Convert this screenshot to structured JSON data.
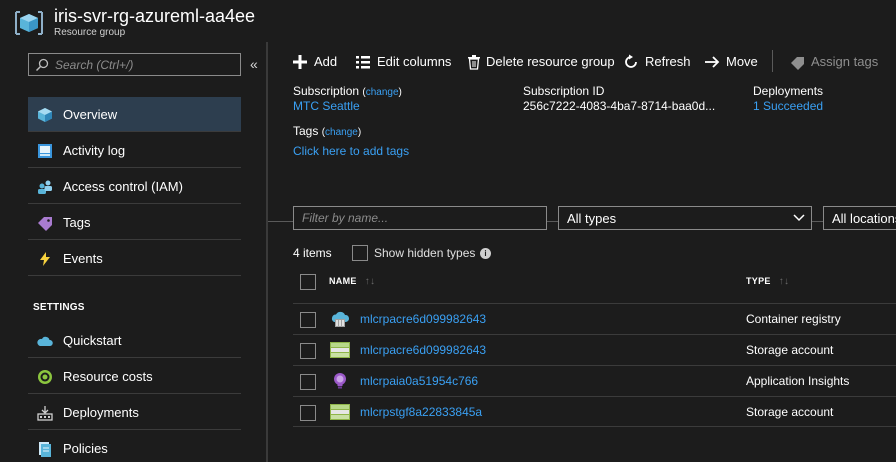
{
  "header": {
    "title": "iris-svr-rg-azureml-aa4ee",
    "subtitle": "Resource group",
    "icon": "resource-group-cube-icon"
  },
  "sidebar": {
    "search_placeholder": "Search (Ctrl+/)",
    "collapse_glyph": "«",
    "items": [
      {
        "label": "Overview",
        "icon": "overview-cube-icon",
        "active": true
      },
      {
        "label": "Activity log",
        "icon": "activity-log-icon"
      },
      {
        "label": "Access control (IAM)",
        "icon": "people-icon"
      },
      {
        "label": "Tags",
        "icon": "tag-icon"
      },
      {
        "label": "Events",
        "icon": "lightning-icon"
      }
    ],
    "settings_heading": "SETTINGS",
    "settings_items": [
      {
        "label": "Quickstart",
        "icon": "cloud-icon"
      },
      {
        "label": "Resource costs",
        "icon": "cost-icon"
      },
      {
        "label": "Deployments",
        "icon": "deployments-icon"
      },
      {
        "label": "Policies",
        "icon": "policies-icon"
      }
    ]
  },
  "toolbar": {
    "add": "Add",
    "edit_columns": "Edit columns",
    "delete": "Delete resource group",
    "refresh": "Refresh",
    "move": "Move",
    "assign_tags": "Assign tags"
  },
  "essentials": {
    "subscription_label": "Subscription",
    "subscription_change": "change",
    "subscription_value": "MTC Seattle",
    "subscription_id_label": "Subscription ID",
    "subscription_id_value": "256c7222-4083-4ba7-8714-baa0d...",
    "deployments_label": "Deployments",
    "deployments_value": "1 Succeeded",
    "tags_label": "Tags",
    "tags_change": "change",
    "tags_link": "Click here to add tags"
  },
  "filters": {
    "name_placeholder": "Filter by name...",
    "types_value": "All types",
    "locations_value": "All locations"
  },
  "list": {
    "count": "4 items",
    "show_hidden": "Show hidden types",
    "col_name": "NAME",
    "col_type": "TYPE",
    "rows": [
      {
        "name": "mlcrpacre6d099982643",
        "type": "Container registry",
        "icon": "container-registry-icon"
      },
      {
        "name": "mlcrpacre6d099982643",
        "type": "Storage account",
        "icon": "storage-account-icon"
      },
      {
        "name": "mlcrpaia0a51954c766",
        "type": "Application Insights",
        "icon": "app-insights-bulb-icon"
      },
      {
        "name": "mlcrpstgf8a22833845a",
        "type": "Storage account",
        "icon": "storage-account-icon"
      }
    ]
  },
  "colors": {
    "background": "#1c1c1c",
    "link": "#3aa0f3",
    "active_nav": "#2d3e4f",
    "divider": "#3b3b3b"
  }
}
